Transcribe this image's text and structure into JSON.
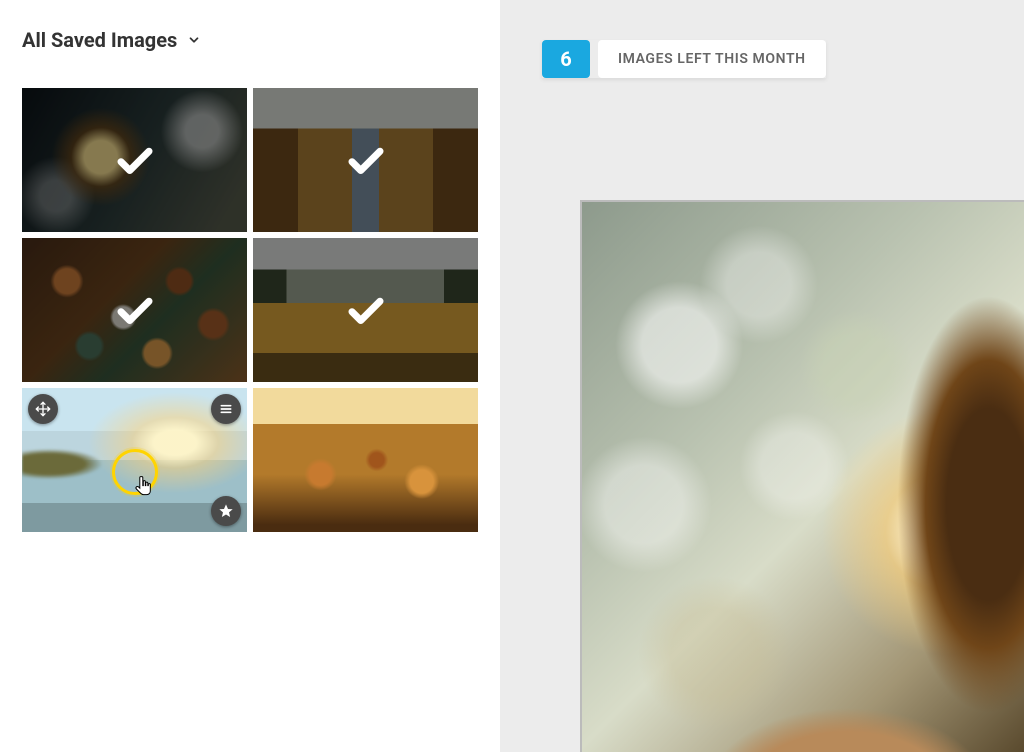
{
  "sidebar": {
    "dropdown_label": "All Saved Images",
    "thumbnails": [
      {
        "selected": true
      },
      {
        "selected": true
      },
      {
        "selected": true
      },
      {
        "selected": true
      },
      {
        "selected": false,
        "active_hover": true
      },
      {
        "selected": false
      }
    ],
    "icons": {
      "move": "move-icon",
      "menu": "menu-icon",
      "star": "star-icon"
    }
  },
  "quota": {
    "count": "6",
    "label": "IMAGES LEFT THIS MONTH"
  },
  "colors": {
    "accent": "#1aa8e0",
    "highlight_ring": "#ffd400"
  }
}
